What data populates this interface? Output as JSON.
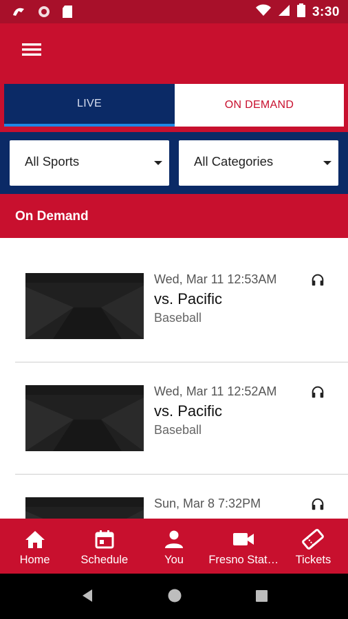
{
  "status_bar": {
    "time": "3:30"
  },
  "tabs": [
    {
      "label": "LIVE",
      "active": true
    },
    {
      "label": "ON DEMAND",
      "active": false
    }
  ],
  "filters": {
    "sports": "All Sports",
    "categories": "All Categories"
  },
  "section": {
    "title": "On Demand"
  },
  "items": [
    {
      "date": "Wed, Mar 11 12:53AM",
      "title": "vs. Pacific",
      "sport": "Baseball"
    },
    {
      "date": "Wed, Mar 11 12:52AM",
      "title": "vs. Pacific",
      "sport": "Baseball"
    },
    {
      "date": "Sun, Mar 8 7:32PM",
      "title": "",
      "sport": ""
    }
  ],
  "bottom_nav": [
    {
      "label": "Home",
      "icon": "home-icon"
    },
    {
      "label": "Schedule",
      "icon": "calendar-icon"
    },
    {
      "label": "You",
      "icon": "person-icon"
    },
    {
      "label": "Fresno Stat…",
      "icon": "video-camera-icon"
    },
    {
      "label": "Tickets",
      "icon": "ticket-icon"
    }
  ],
  "colors": {
    "primary_red": "#c8102e",
    "navy": "#0b2a66",
    "status_bar": "#a8102a"
  }
}
